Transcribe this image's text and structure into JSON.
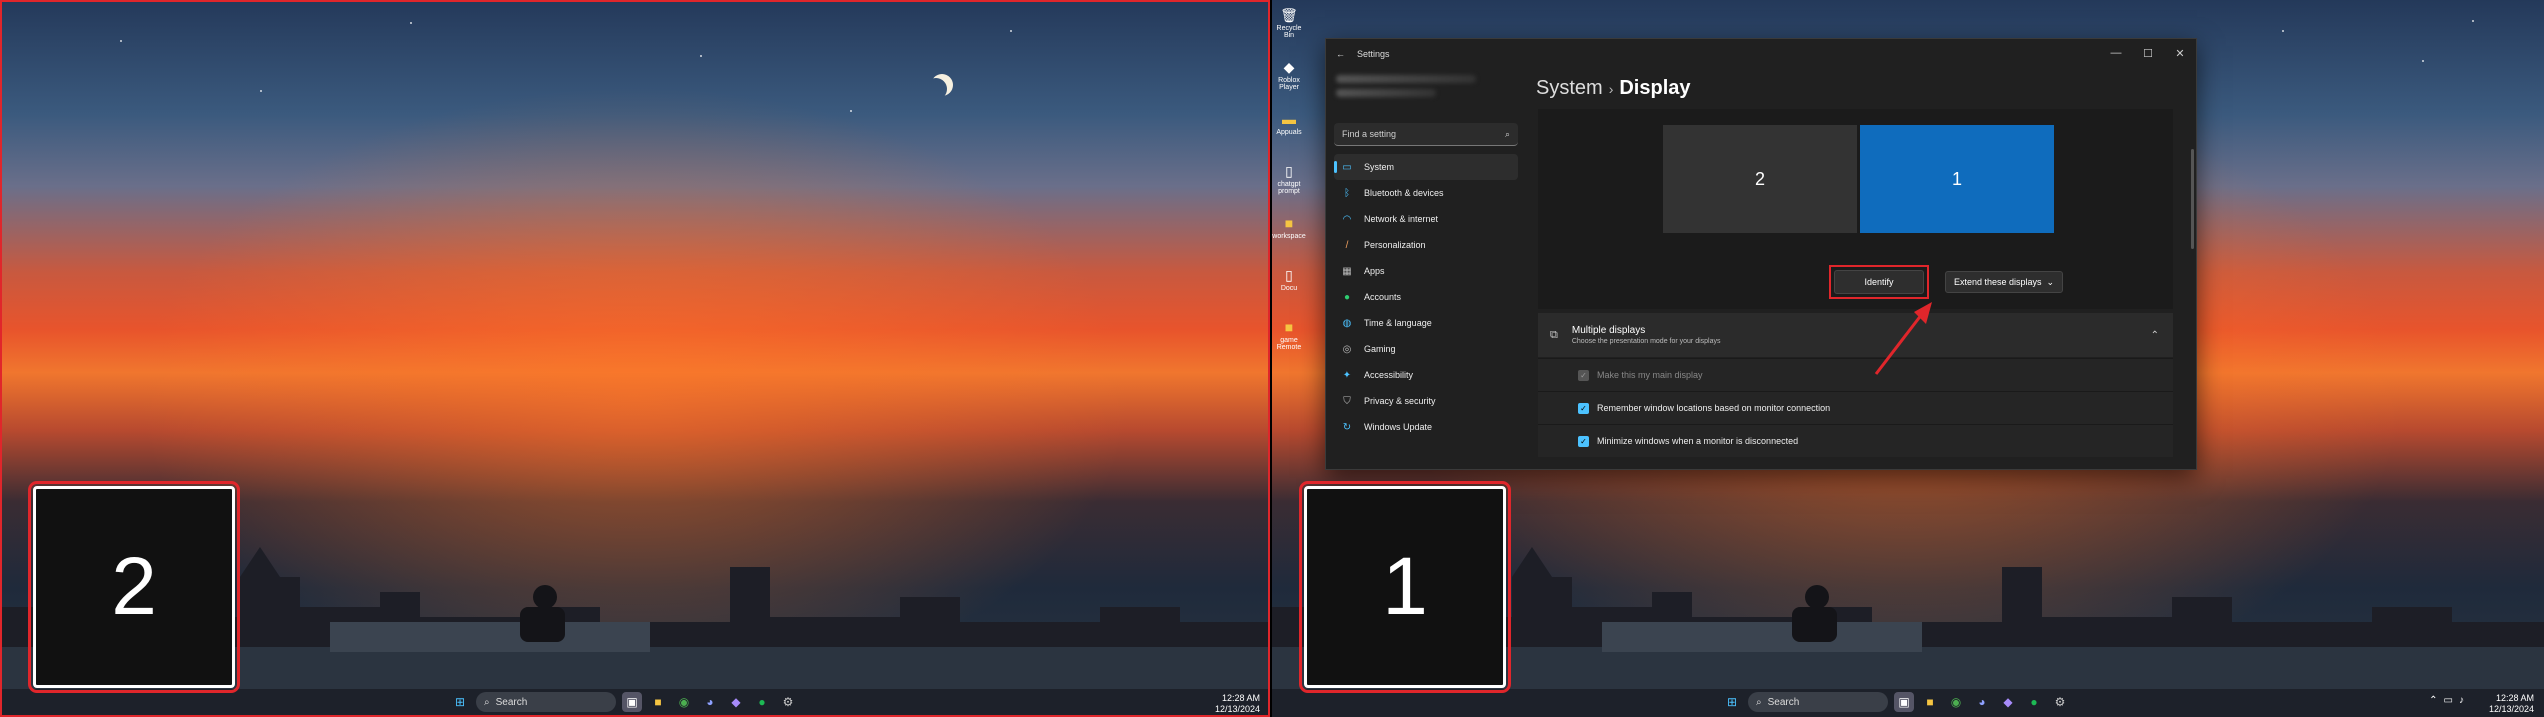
{
  "left_monitor": {
    "identify_number": "2"
  },
  "right_monitor": {
    "identify_number": "1"
  },
  "taskbar": {
    "search_label": "Search",
    "time": "12:28 AM",
    "date": "12/13/2024"
  },
  "desktop_icons": [
    {
      "label": "Recycle Bin",
      "icon": "recycle-bin-icon"
    },
    {
      "label": "Roblox Player",
      "icon": "roblox-icon"
    },
    {
      "label": "Appuals",
      "icon": "app-icon"
    },
    {
      "label": "chatgpt prompt",
      "icon": "document-icon"
    },
    {
      "label": "workspace",
      "icon": "folder-icon"
    },
    {
      "label": "Docu",
      "icon": "document-icon"
    },
    {
      "label": "game Remote",
      "icon": "folder-icon"
    }
  ],
  "settings": {
    "window_title": "Settings",
    "search_placeholder": "Find a setting",
    "breadcrumb_parent": "System",
    "breadcrumb_current": "Display",
    "nav": [
      {
        "label": "System",
        "icon": "system-icon",
        "active": true
      },
      {
        "label": "Bluetooth & devices",
        "icon": "bluetooth-icon"
      },
      {
        "label": "Network & internet",
        "icon": "wifi-icon"
      },
      {
        "label": "Personalization",
        "icon": "brush-icon"
      },
      {
        "label": "Apps",
        "icon": "apps-icon"
      },
      {
        "label": "Accounts",
        "icon": "person-icon"
      },
      {
        "label": "Time & language",
        "icon": "globe-icon"
      },
      {
        "label": "Gaming",
        "icon": "gamepad-icon"
      },
      {
        "label": "Accessibility",
        "icon": "accessibility-icon"
      },
      {
        "label": "Privacy & security",
        "icon": "shield-icon"
      },
      {
        "label": "Windows Update",
        "icon": "update-icon"
      }
    ],
    "displays": {
      "display_2": "2",
      "display_1": "1"
    },
    "identify_label": "Identify",
    "extend_label": "Extend these displays",
    "multiple_displays": {
      "title": "Multiple displays",
      "subtitle": "Choose the presentation mode for your displays"
    },
    "options": [
      {
        "label": "Make this my main display",
        "checked": true,
        "disabled": true
      },
      {
        "label": "Remember window locations based on monitor connection",
        "checked": true,
        "disabled": false
      },
      {
        "label": "Minimize windows when a monitor is disconnected",
        "checked": true,
        "disabled": false
      }
    ]
  },
  "colors": {
    "accent": "#4cc2ff",
    "selected_display": "#0f6cbd",
    "highlight_red": "#e0262b"
  }
}
